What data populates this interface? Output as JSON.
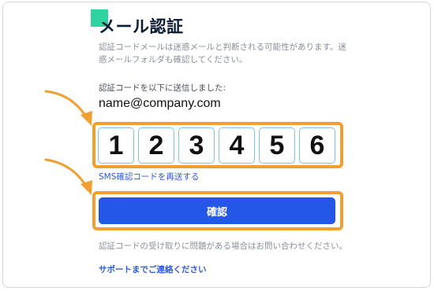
{
  "header": {
    "title": "メール認証"
  },
  "description": "認証コードメールは迷惑メールと判断される可能性があります。迷惑メールフォルダも確認してください。",
  "sent_label": "認証コードを以下に送信しました:",
  "email": "name@company.com",
  "code": {
    "digits": [
      "1",
      "2",
      "3",
      "4",
      "5",
      "6"
    ]
  },
  "resend_link": "SMS確認コードを再送する",
  "confirm_button": "確認",
  "help_text": "認証コードの受け取りに問題がある場合はお問い合わせください。",
  "support_link": "サポートまでご連絡ください",
  "colors": {
    "accent": "#2ed3a0",
    "primary": "#2456e8",
    "highlight": "#f0a030",
    "link": "#2e5bd8"
  }
}
